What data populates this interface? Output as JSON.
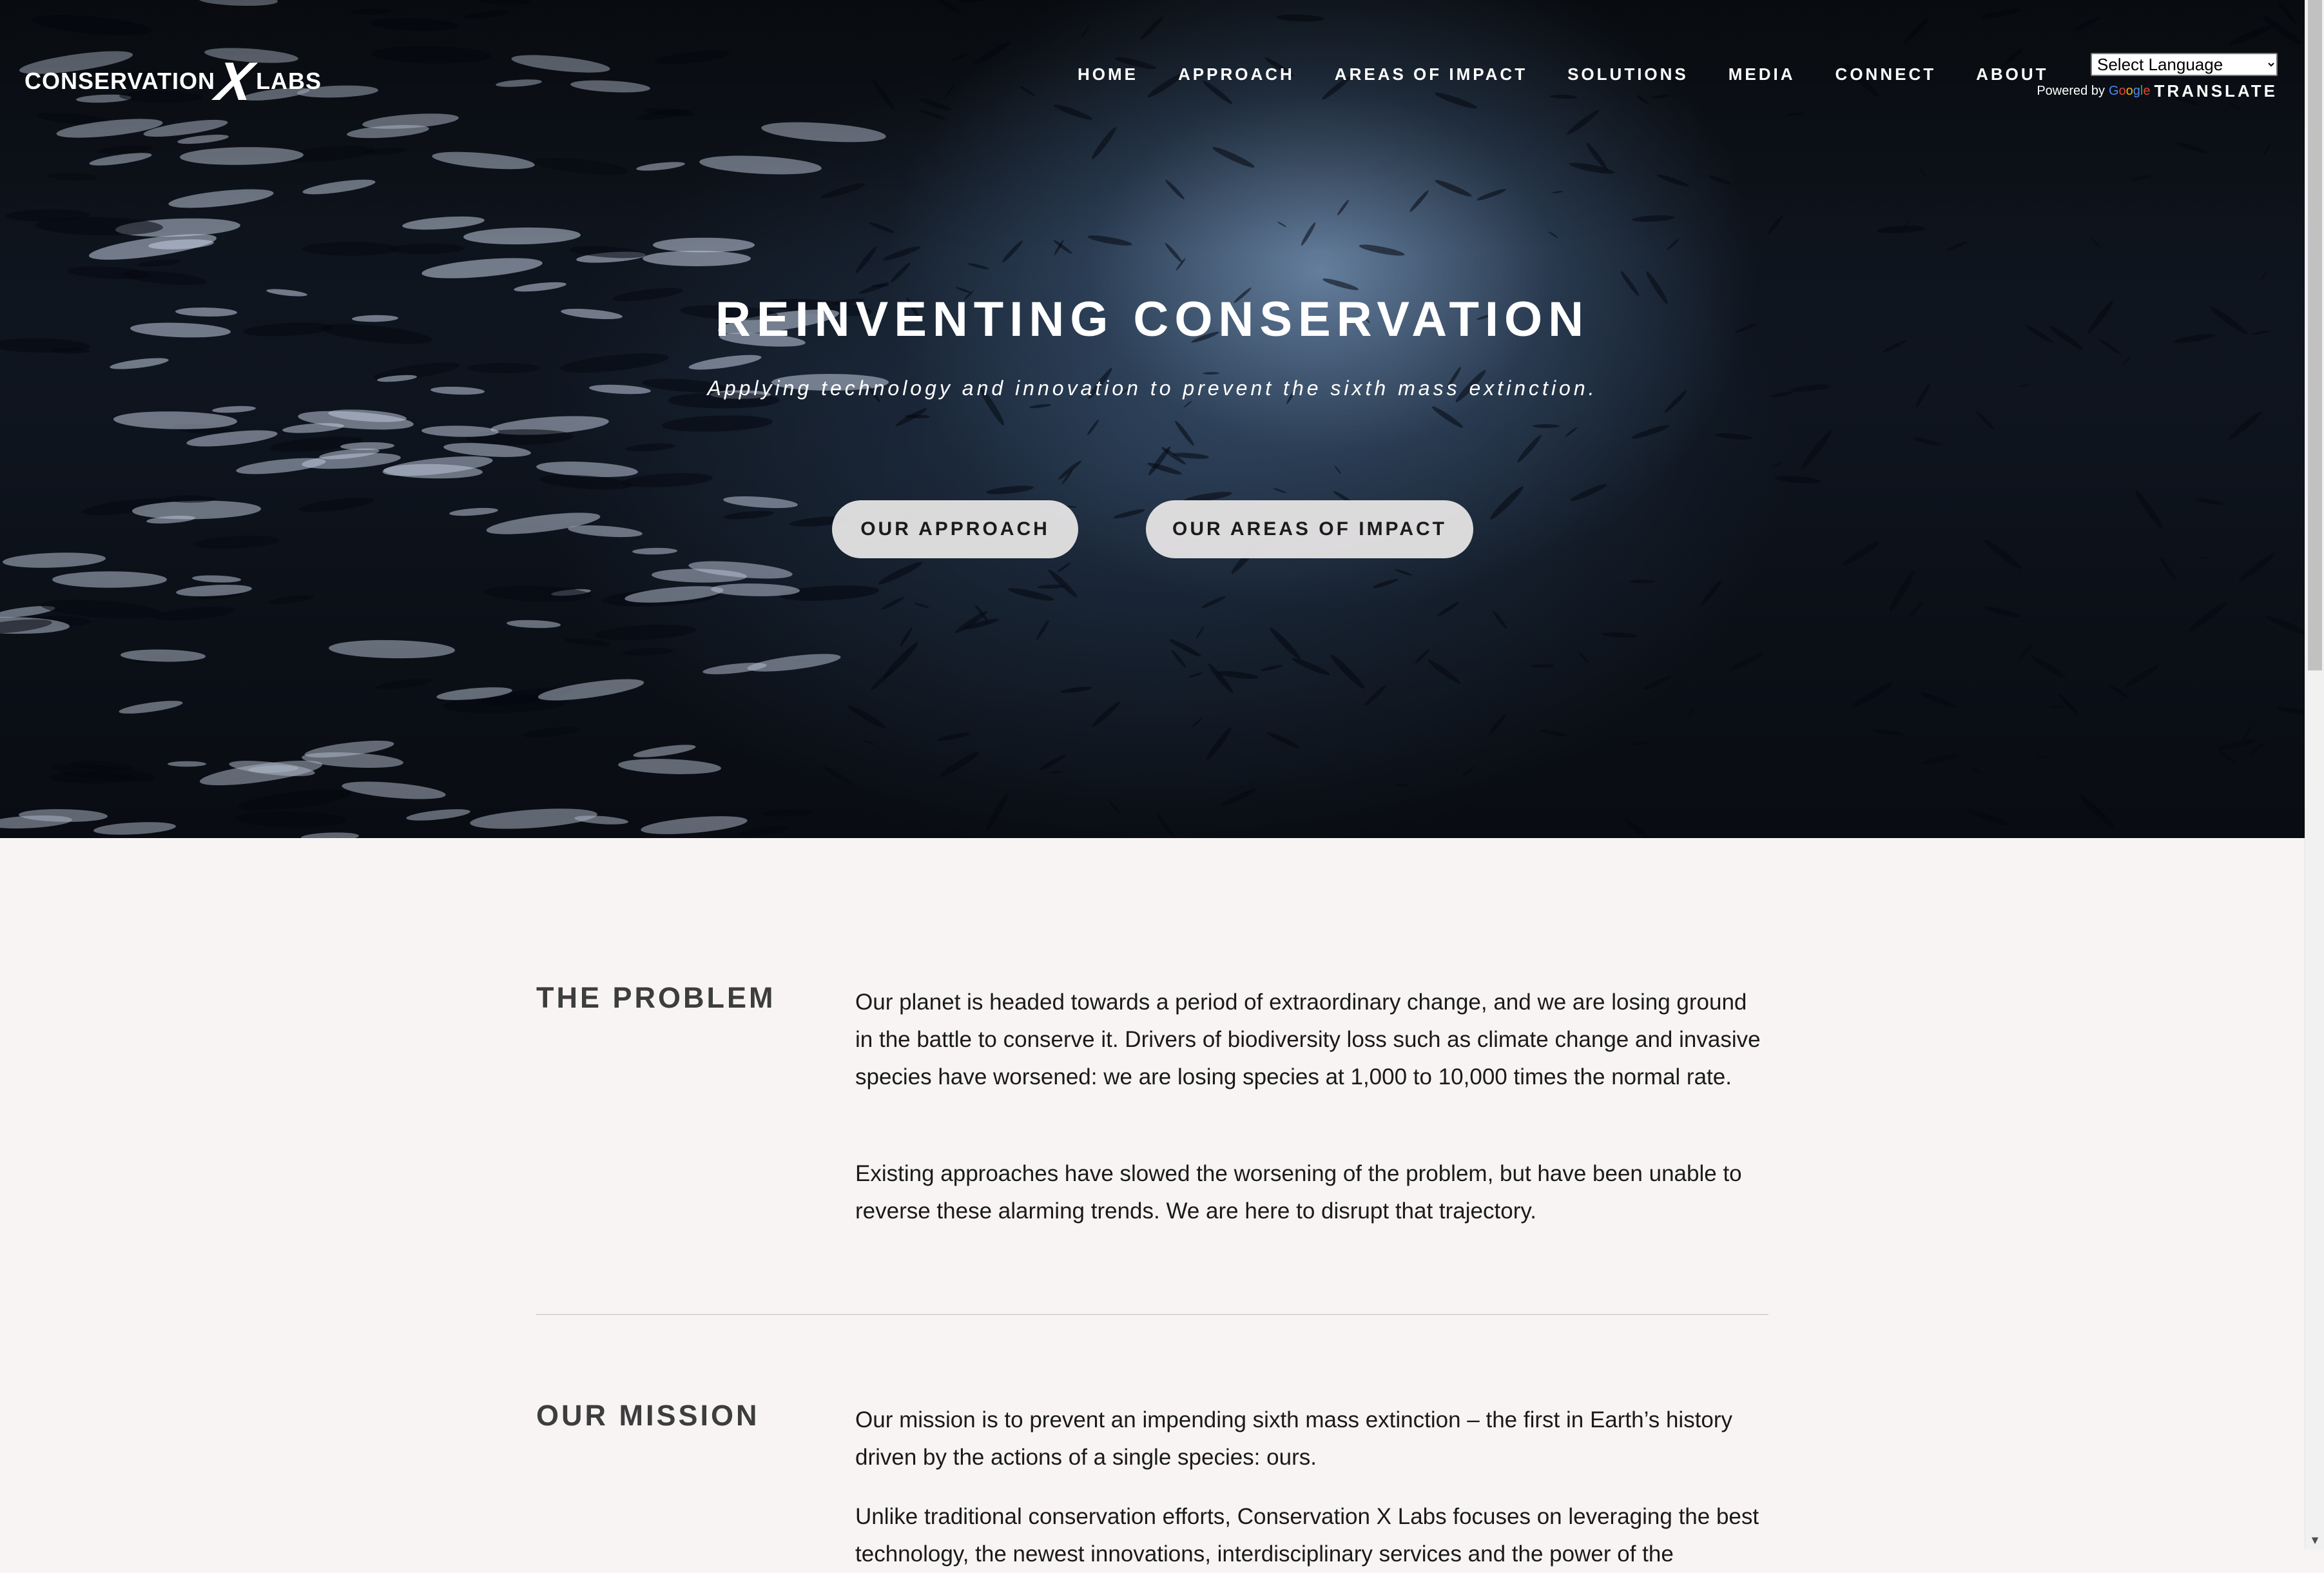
{
  "header": {
    "logo_left": "CONSERVATION",
    "logo_x": "X",
    "logo_right": "LABS",
    "nav": [
      "HOME",
      "APPROACH",
      "AREAS OF IMPACT",
      "SOLUTIONS",
      "MEDIA",
      "CONNECT",
      "ABOUT"
    ],
    "translate": {
      "select_value": "Select Language",
      "powered_by": "Powered by",
      "google": "Google",
      "translate_label": "TRANSLATE"
    }
  },
  "hero": {
    "title": "REINVENTING CONSERVATION",
    "subtitle": "Applying technology and innovation to prevent the sixth mass extinction.",
    "button_approach": "OUR APPROACH",
    "button_impact": "OUR AREAS OF IMPACT"
  },
  "problem": {
    "heading": "THE PROBLEM",
    "paragraphs": [
      "Our planet is headed towards a period of extraordinary change, and we are losing ground in the battle to conserve it. Drivers of biodiversity loss such as climate change and invasive species have worsened: we are losing species at 1,000 to 10,000 times the normal rate.",
      "Existing approaches have slowed the worsening of the problem, but have been unable to reverse these alarming trends. We are here to disrupt that trajectory."
    ]
  },
  "mission": {
    "heading": "OUR MISSION",
    "paragraphs": [
      "Our mission is to prevent an impending sixth mass extinction – the first in Earth’s history driven by the actions of a single species: ours.",
      "Unlike traditional conservation efforts, Conservation X Labs focuses on leveraging the best technology, the newest innovations, interdisciplinary services and the power of the"
    ]
  },
  "colors": {
    "page_background": "#f7f4f3",
    "heading": "#3d3d3d",
    "body_text": "#1a1a1a",
    "hero_button": "#e8e6e6"
  }
}
